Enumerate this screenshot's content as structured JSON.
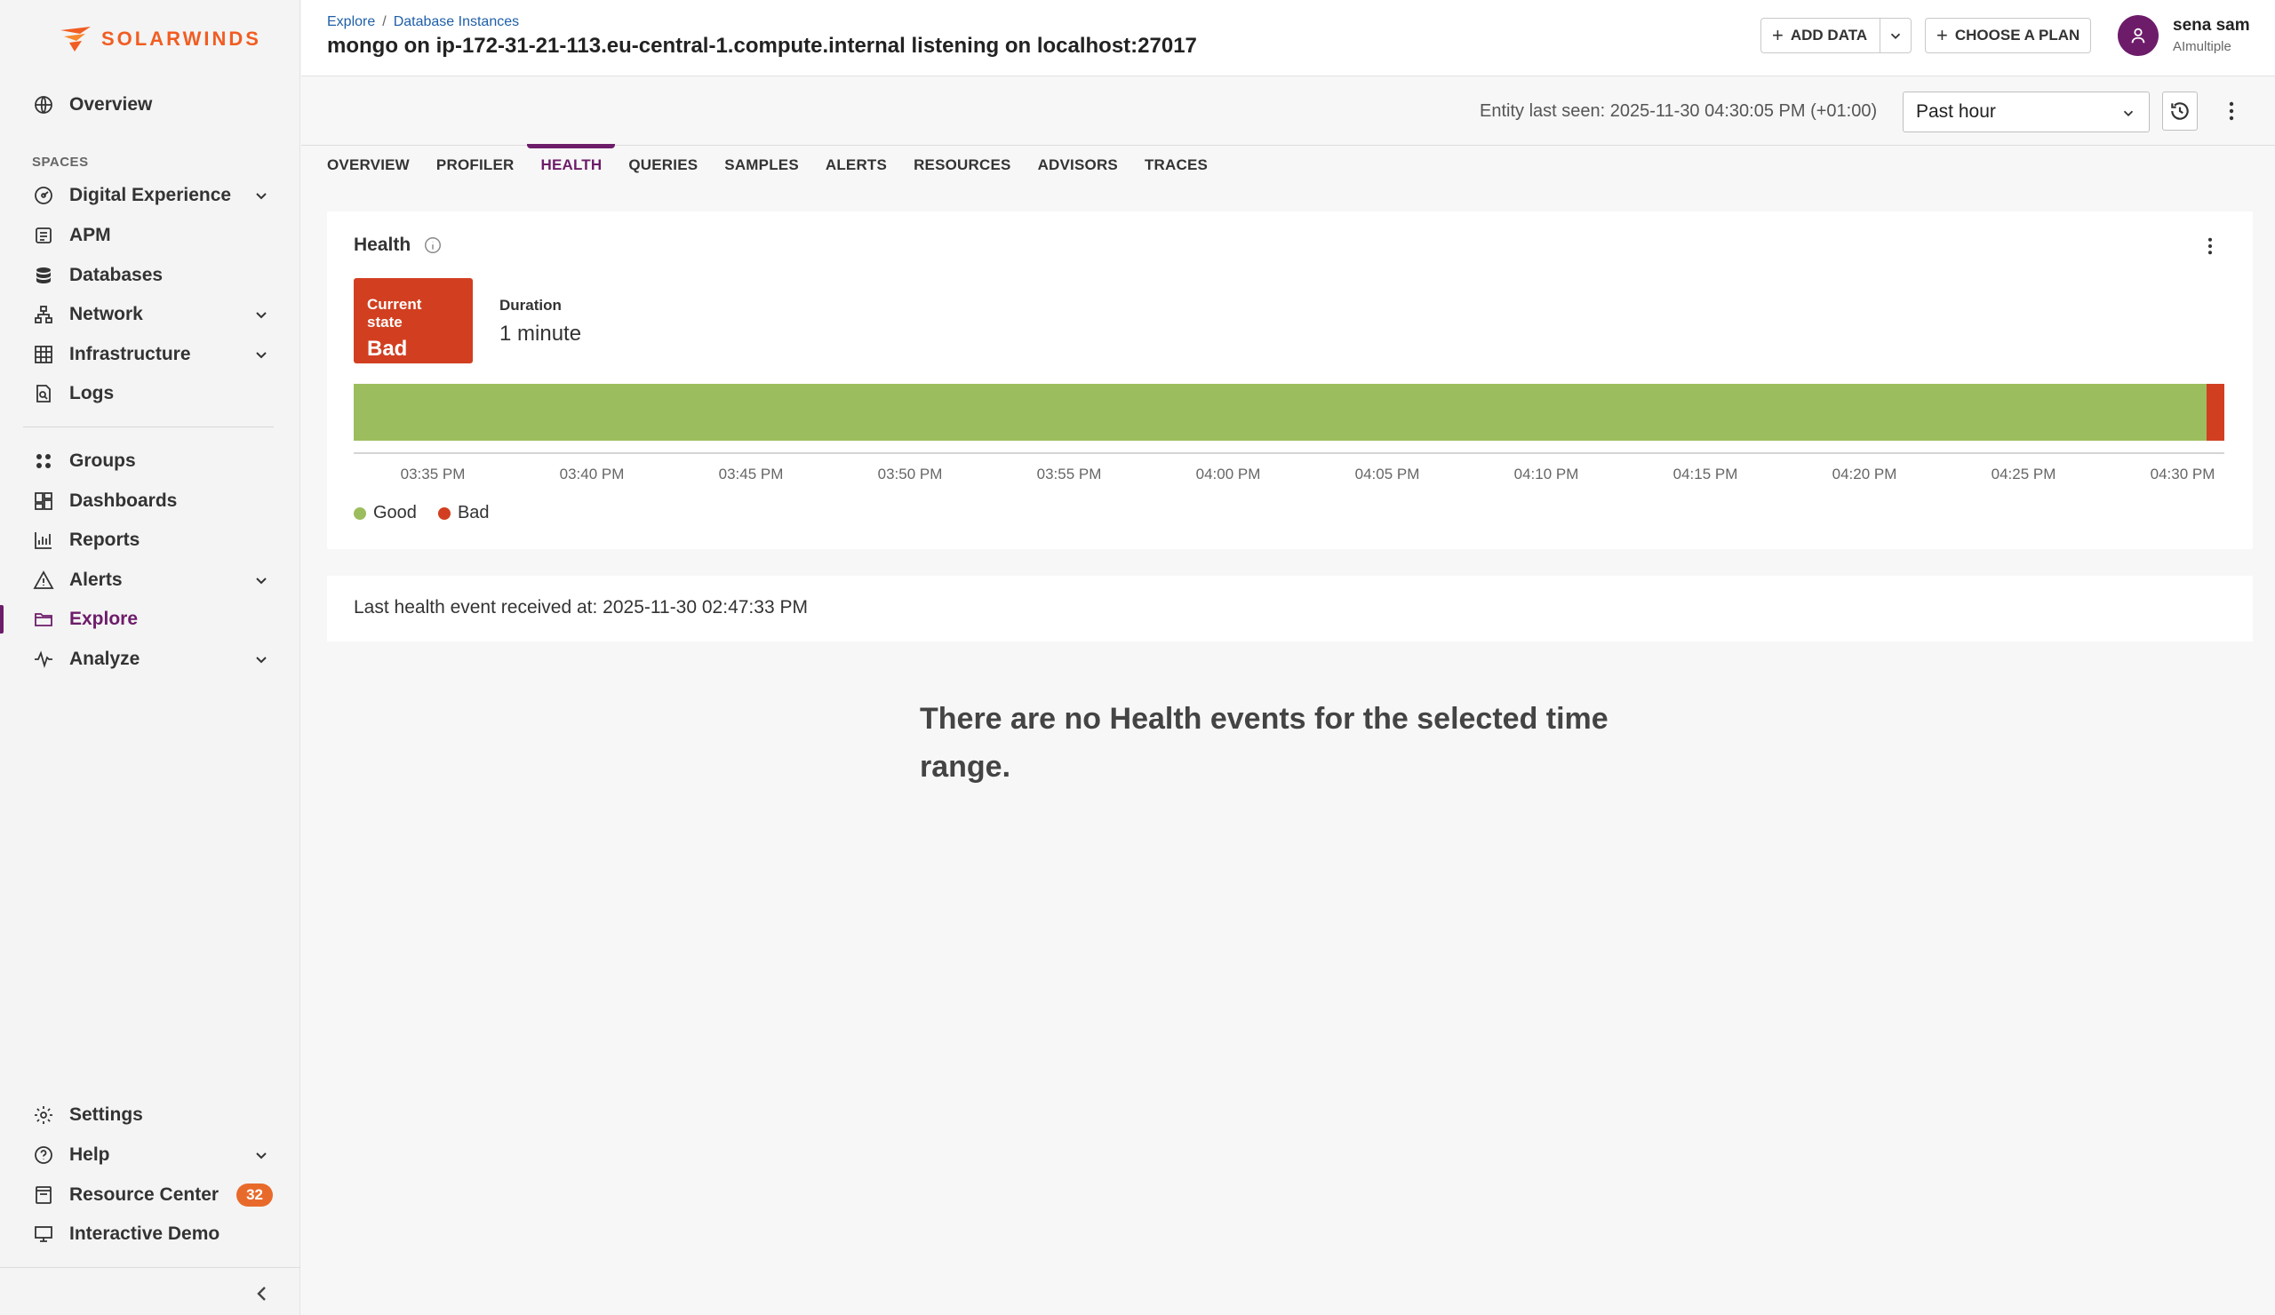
{
  "brand": {
    "name": "SOLARWINDS",
    "accent": "#f15d22"
  },
  "sidebar": {
    "overview": "Overview",
    "spaces_label": "SPACES",
    "items": [
      {
        "label": "Digital Experience",
        "icon": "digital-experience-icon"
      },
      {
        "label": "APM",
        "icon": "apm-icon"
      },
      {
        "label": "Databases",
        "icon": "database-icon"
      },
      {
        "label": "Network",
        "icon": "network-icon"
      },
      {
        "label": "Infrastructure",
        "icon": "infrastructure-icon"
      },
      {
        "label": "Logs",
        "icon": "logs-icon"
      }
    ],
    "items2": [
      {
        "label": "Groups",
        "icon": "groups-icon"
      },
      {
        "label": "Dashboards",
        "icon": "dashboards-icon"
      },
      {
        "label": "Reports",
        "icon": "reports-icon"
      },
      {
        "label": "Alerts",
        "icon": "alerts-icon"
      },
      {
        "label": "Explore",
        "icon": "explore-icon"
      },
      {
        "label": "Analyze",
        "icon": "analyze-icon"
      }
    ],
    "bottom": [
      {
        "label": "Settings",
        "icon": "gear-icon"
      },
      {
        "label": "Help",
        "icon": "help-icon"
      },
      {
        "label": "Resource Center",
        "icon": "resource-center-icon",
        "badge": "32"
      },
      {
        "label": "Interactive Demo",
        "icon": "monitor-icon"
      }
    ]
  },
  "header": {
    "breadcrumb": [
      "Explore",
      "Database Instances"
    ],
    "title": "mongo on ip-172-31-21-113.eu-central-1.compute.internal listening on localhost:27017",
    "add_data": "ADD DATA",
    "choose_plan": "CHOOSE A PLAN",
    "user_name": "sena sam",
    "user_org": "AImultiple"
  },
  "toolbar": {
    "entity_seen": "Entity last seen: 2025-11-30 04:30:05 PM (+01:00)",
    "range": "Past hour"
  },
  "tabs": [
    "OVERVIEW",
    "PROFILER",
    "HEALTH",
    "QUERIES",
    "SAMPLES",
    "ALERTS",
    "RESOURCES",
    "ADVISORS",
    "TRACES"
  ],
  "active_tab": "HEALTH",
  "health": {
    "title": "Health",
    "current_state_label": "Current state",
    "current_state": "Bad",
    "duration_label": "Duration",
    "duration": "1 minute",
    "ticks": [
      "03:35 PM",
      "03:40 PM",
      "03:45 PM",
      "03:50 PM",
      "03:55 PM",
      "04:00 PM",
      "04:05 PM",
      "04:10 PM",
      "04:15 PM",
      "04:20 PM",
      "04:25 PM",
      "04:30 PM"
    ],
    "legend": [
      {
        "label": "Good",
        "color": "#9cbd5e"
      },
      {
        "label": "Bad",
        "color": "#d13f20"
      }
    ]
  },
  "last_event": "Last health event received at: 2025-11-30 02:47:33 PM",
  "empty_message": "There are no Health events for the selected time range."
}
